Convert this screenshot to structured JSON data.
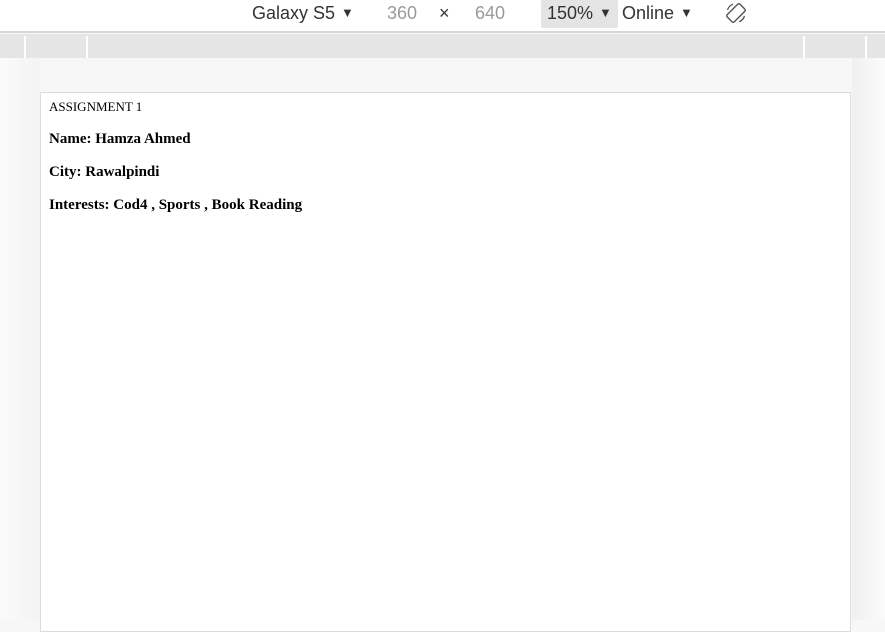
{
  "toolbar": {
    "device": "Galaxy S5",
    "width": "360",
    "times": "×",
    "height": "640",
    "zoom": "150%",
    "network": "Online",
    "caret": "▼"
  },
  "page": {
    "heading": "ASSIGNMENT 1",
    "name_line": "Name: Hamza Ahmed",
    "city_line": "City: Rawalpindi",
    "interests_line": "Interests: Cod4 , Sports , Book Reading"
  }
}
